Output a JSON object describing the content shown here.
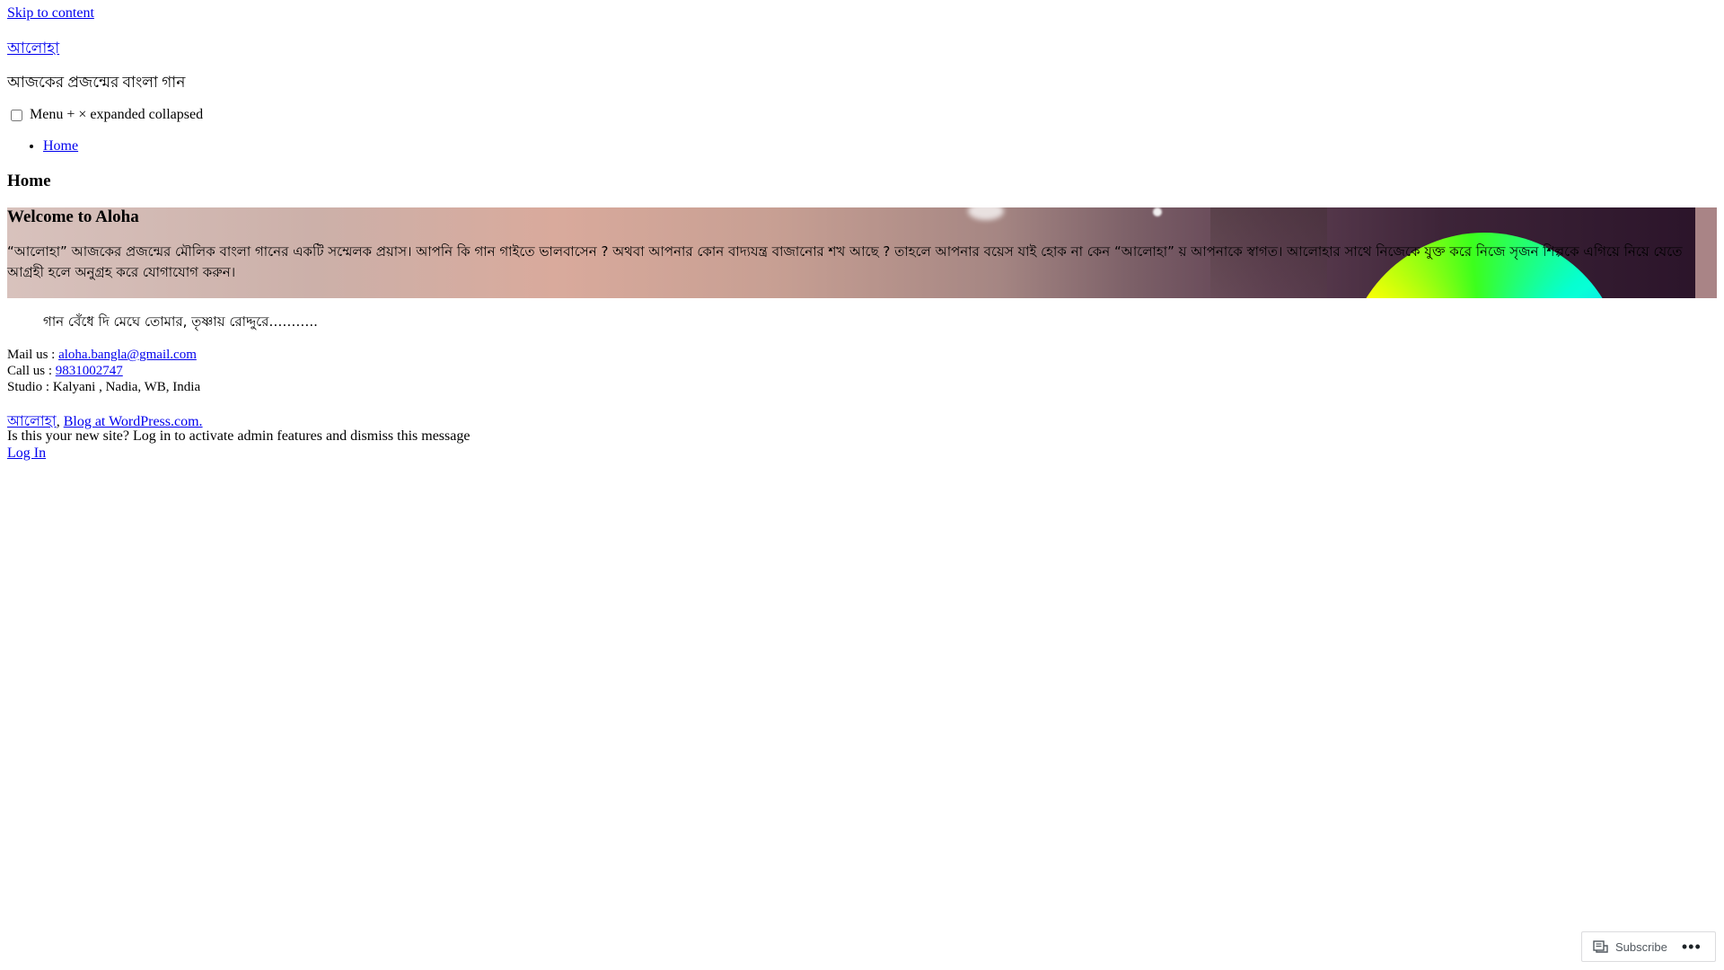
{
  "skip_link": "Skip to content",
  "site": {
    "title": "আলোহা",
    "tagline": "আজকের প্রজন্মের বাংলা গান"
  },
  "menu_toggle": {
    "label": "Menu + × expanded collapsed",
    "checked": false
  },
  "nav": {
    "items": [
      {
        "label": "Home"
      }
    ]
  },
  "page": {
    "heading": "Home"
  },
  "hero": {
    "title": "Welcome to Aloha",
    "text": "“আলোহা”  আজকের প্রজন্মের মৌলিক বাংলা গানের একটি সম্মেলক প্রয়াস।  আপনি কি গান গাইতে ভালবাসেন ? অথবা আপনার কোন বাদ্যযন্ত্র বাজানোর শখ আছে ? তাহলে আপনার বয়েস যাই হোক না কেন “আলোহা” য় আপনাকে স্বাগত। আলোহার  সাথে নিজেকে যুক্ত করে নিজে সৃজন শিল্পকে এগিয়ে নিয়ে যেতে আগ্রহী হলে অনুগ্রহ করে যোগাযোগ করুন।"
  },
  "quote": "গান বেঁধে দি মেঘে তোমার, তৃষ্ণায় রোদ্দুরে………..",
  "contact": {
    "mail_label": "Mail us : ",
    "mail_value": "aloha.bangla@gmail.com",
    "call_label": "Call us : ",
    "call_value": "9831002747",
    "studio": "Studio : Kalyani , Nadia, WB, India"
  },
  "footer": {
    "site_link": "আলোহা",
    "separator": ", ",
    "wp_link": "Blog at WordPress.com."
  },
  "admin": {
    "message": "Is this your new site? Log in to activate admin features and dismiss this message",
    "login": "Log In"
  },
  "subscribe_bar": {
    "subscribe_label": "Subscribe",
    "more_label": "•••",
    "subscribe_icon": "reader-icon",
    "more_icon": "ellipsis-icon"
  }
}
